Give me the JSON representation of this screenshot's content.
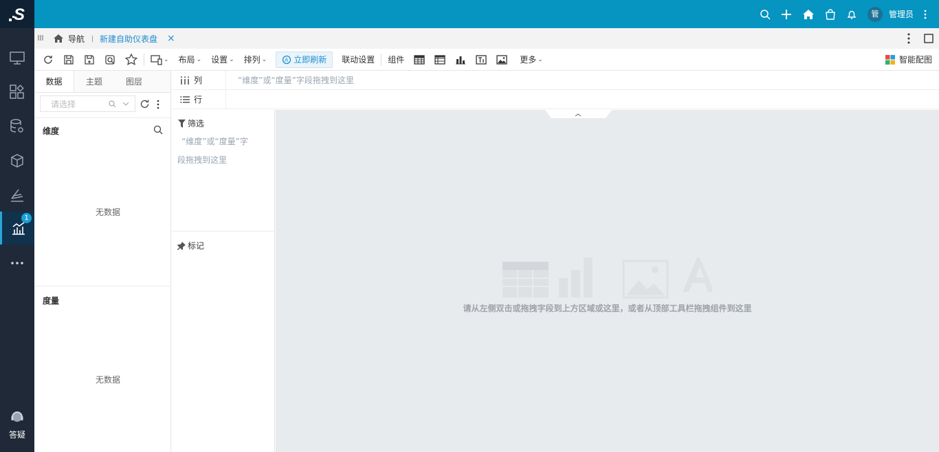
{
  "brand": {
    "logo_letter": "S"
  },
  "rail": {
    "items": [
      "monitor-icon",
      "widgets-icon",
      "database-gear-icon",
      "cube-icon",
      "chart-slope-icon",
      "bar-chart-icon",
      "more-icon"
    ],
    "active_badge": "1",
    "help_label": "答疑"
  },
  "topbar": {
    "user_avatar": "管",
    "user_name": "管理员"
  },
  "tabs": {
    "nav_label": "导航",
    "active_tab": "新建自助仪表盘",
    "close": "×"
  },
  "toolbar": {
    "device_label": "",
    "layout_label": "布局",
    "settings_label": "设置",
    "arrange_label": "排列",
    "refresh_label": "立即刷新",
    "linkage_label": "联动设置",
    "components_label": "组件",
    "more_label": "更多",
    "smart_label": "智能配图"
  },
  "left": {
    "tabs": [
      "数据",
      "主题",
      "图层"
    ],
    "search_placeholder": "请选择",
    "dimension_title": "维度",
    "measure_title": "度量",
    "empty_text": "无数据"
  },
  "shelf": {
    "columns_label": "列",
    "rows_label": "行",
    "drop_hint": "“维度”或“度量”字段拖拽到这里"
  },
  "mid": {
    "filter_label": "筛选",
    "filter_hint_line1": "“维度”或“度量”字",
    "filter_hint_line2": "段拖拽到这里",
    "mark_label": "标记"
  },
  "canvas": {
    "hint": "请从左侧双击或拖拽字段到上方区域或这里，或者从顶部工具栏拖拽组件到这里"
  },
  "colors": {
    "topbar": "#0694c1",
    "rail": "#1f2937",
    "accent": "#1f8ed0",
    "canvas": "#e8ebee"
  }
}
